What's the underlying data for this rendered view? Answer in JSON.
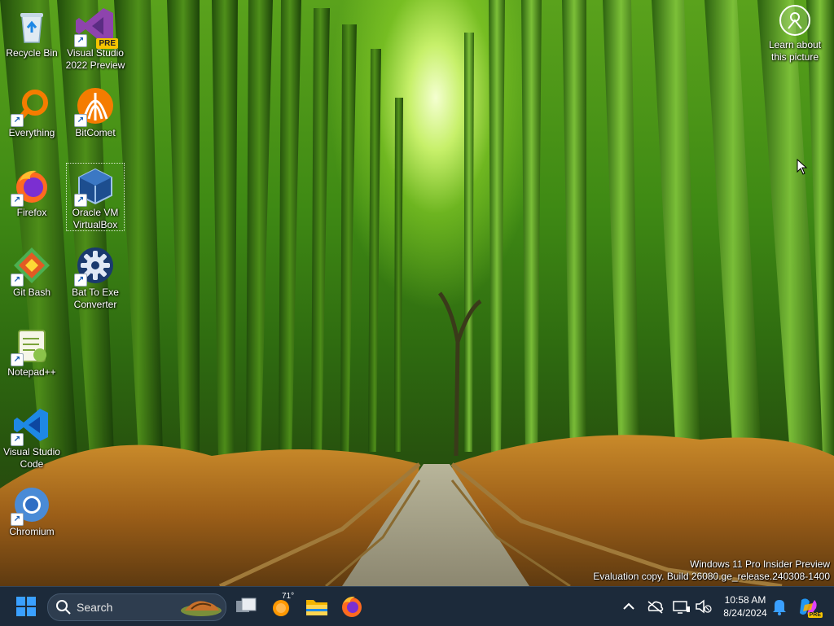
{
  "desktop": {
    "icons": [
      {
        "label": "Recycle Bin"
      },
      {
        "label": "Visual Studio\n2022 Preview",
        "badge": "PRE"
      },
      {
        "label": "Everything"
      },
      {
        "label": "BitComet"
      },
      {
        "label": "Firefox"
      },
      {
        "label": "Oracle VM\nVirtualBox"
      },
      {
        "label": "Git Bash"
      },
      {
        "label": "Bat To Exe\nConverter"
      },
      {
        "label": "Notepad++"
      },
      {
        "label": "Visual Studio\nCode"
      },
      {
        "label": "Chromium"
      }
    ],
    "learn_label": "Learn about\nthis picture",
    "watermark": {
      "line1": "Windows 11 Pro Insider Preview",
      "line2": "Evaluation copy. Build 26080.ge_release.240308-1400"
    }
  },
  "taskbar": {
    "search_placeholder": "Search",
    "weather_temp": "71°",
    "time": "10:58 AM",
    "date": "8/24/2024",
    "accent": "#0078d4"
  }
}
